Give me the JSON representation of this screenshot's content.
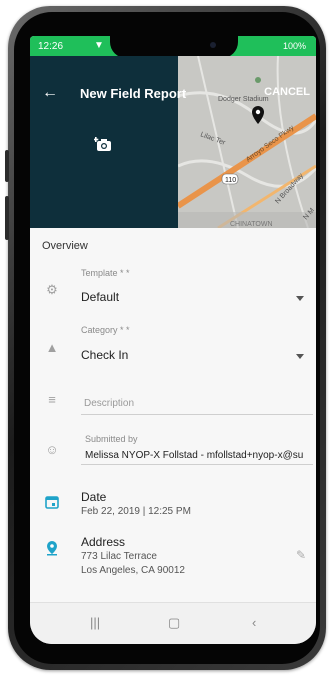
{
  "status_bar": {
    "time": "12:26",
    "battery": "100%"
  },
  "header": {
    "title": "New Field Report",
    "cancel_label": "CANCEL"
  },
  "map": {
    "labels": {
      "dodger_stadium": "Dodger Stadium",
      "lilac_ter": "Lilac Ter",
      "arroyo_seco": "Arroyo Seco Pkwy",
      "highway": "110",
      "n_broadway": "N Broadway",
      "chinatown": "CHINATOWN",
      "n_m": "N M"
    }
  },
  "form": {
    "section_title": "Overview",
    "template": {
      "label": "Template * *",
      "value": "Default"
    },
    "category": {
      "label": "Category * *",
      "value": "Check In"
    },
    "description": {
      "placeholder": "Description"
    },
    "submitted_by": {
      "label": "Submitted by",
      "value": "Melissa NYOP-X Follstad - mfollstad+nyop-x@su"
    },
    "date": {
      "title": "Date",
      "value": "Feb 22, 2019 | 12:25 PM"
    },
    "address": {
      "title": "Address",
      "line1": "773 Lilac Terrace",
      "line2": "Los Angeles, CA 90012"
    }
  },
  "colors": {
    "status_bar": "#1fbf5a",
    "header": "#0e2f3b",
    "accent": "#1fa3c9"
  },
  "icons": [
    "back-arrow-icon",
    "add-photo-icon",
    "location-pin-icon",
    "gear-icon",
    "category-icon",
    "description-icon",
    "person-icon",
    "calendar-icon",
    "location-icon",
    "edit-icon"
  ]
}
